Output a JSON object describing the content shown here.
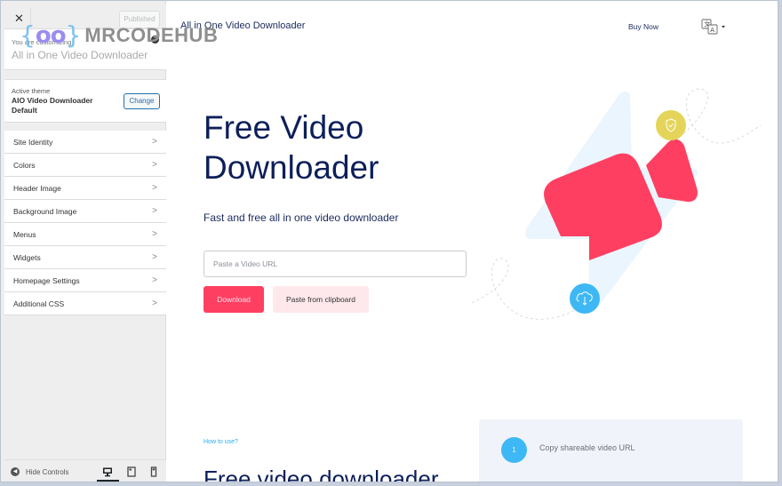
{
  "sidebar": {
    "close_label": "✕",
    "publish_label": "Published",
    "customizing_label": "You are customizing",
    "site_name": "All in One Video Downloader",
    "help_glyph": "?",
    "active_theme_label": "Active theme",
    "theme_name": "AIO Video Downloader Default",
    "change_label": "Change",
    "menu": [
      {
        "label": "Site Identity"
      },
      {
        "label": "Colors"
      },
      {
        "label": "Header Image"
      },
      {
        "label": "Background Image"
      },
      {
        "label": "Menus"
      },
      {
        "label": "Widgets"
      },
      {
        "label": "Homepage Settings"
      },
      {
        "label": "Additional CSS"
      }
    ],
    "chevron_glyph": ">",
    "hide_controls_label": "Hide Controls",
    "hide_glyph": "◀",
    "devices": [
      "desktop",
      "tablet",
      "mobile"
    ],
    "active_device": "desktop"
  },
  "watermark": {
    "brace_open": "{",
    "oo": "oo",
    "brace_close": "}",
    "text": "MRCODEHUB"
  },
  "preview": {
    "site_title": "All in One Video Downloader",
    "nav": {
      "buy_now": "Buy Now",
      "language_icon": "translate-icon"
    },
    "hero": {
      "title_line1": "Free Video",
      "title_line2": "Downloader",
      "subtitle": "Fast and free all in one video downloader",
      "input_placeholder": "Paste a Video URL",
      "download_label": "Download",
      "paste_label": "Paste from clipboard"
    },
    "howto": {
      "eyebrow": "How to use?",
      "title": "Free video downloader",
      "steps": [
        {
          "number": "1",
          "text": "Copy shareable video URL"
        }
      ]
    },
    "colors": {
      "primary": "#fe3f61",
      "navy": "#0d1f5a",
      "blue": "#3db8f5",
      "yellow": "#e4d55a",
      "light_blue": "#eaf5fd"
    }
  }
}
